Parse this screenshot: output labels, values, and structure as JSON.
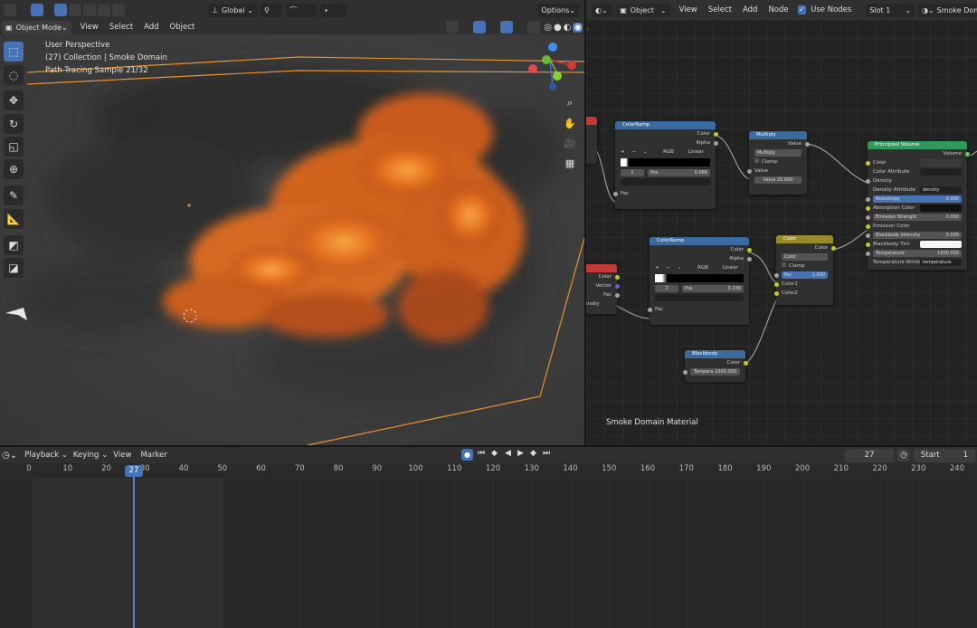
{
  "viewport_header": {
    "mode": "Object Mode",
    "menus": [
      "View",
      "Select",
      "Add",
      "Object"
    ],
    "transform_orientation": "Global",
    "options": "Options"
  },
  "viewport_overlay": {
    "line1": "User Perspective",
    "line2": "(27) Collection | Smoke Domain",
    "line3": "Path Tracing Sample 21/32"
  },
  "node_header": {
    "object": "Object",
    "menus": [
      "View",
      "Select",
      "Add",
      "Node"
    ],
    "use_nodes": "Use Nodes",
    "slot": "Slot 1",
    "material": "Smoke Domain"
  },
  "node_editor": {
    "material_label": "Smoke Domain Material",
    "colorramp1": {
      "title": "ColorRamp",
      "out_color": "Color",
      "out_alpha": "Alpha",
      "mode": "RGB",
      "interp": "Linear",
      "index": "1",
      "pos_label": "Pos",
      "pos": "0.066",
      "in_fac": "Fac"
    },
    "colorramp2": {
      "title": "ColorRamp",
      "out_color": "Color",
      "out_alpha": "Alpha",
      "mode": "RGB",
      "interp": "Linear",
      "index": "2",
      "pos_label": "Pos",
      "pos": "0.239",
      "in_fac": "Fac"
    },
    "multiply": {
      "title": "Multiply",
      "out_value": "Value",
      "op": "Multiply",
      "clamp": "Clamp",
      "in_value": "Value",
      "value_field": "Value 20.000"
    },
    "mix": {
      "title": "Color",
      "out_color": "Color",
      "blend": "Color",
      "clamp": "Clamp",
      "fac": "Fac",
      "fac_val": "1.000",
      "color1": "Color1",
      "color2": "Color2"
    },
    "blackbody": {
      "title": "Blackbody",
      "out_color": "Color",
      "temp": "Tempera 1000.000"
    },
    "attr_node": {
      "color": "Color",
      "vector": "Vector",
      "fac": "Fac",
      "partial": "ensity"
    },
    "principled": {
      "title": "Principled Volume",
      "out": "Volume",
      "rows": [
        "Color",
        "Color Attribute",
        "Density",
        "Density Attribute",
        "Anisotropy",
        "Absorption Color",
        "Emission Strength",
        "Emission Color",
        "Blackbody Intensity",
        "Blackbody Tint",
        "Temperature",
        "Temperature Attribut"
      ],
      "density_attr": "density",
      "anisotropy": "0.000",
      "emission_strength": "0.000",
      "blackbody_intensity": "0.000",
      "temperature": "1000.000",
      "temperature_attr": "temperature"
    }
  },
  "timeline": {
    "menus": [
      "Playback",
      "Keying",
      "View",
      "Marker"
    ],
    "current_frame": "27",
    "start_label": "Start",
    "start_value": "1",
    "ticks": [
      "0",
      "10",
      "20",
      "30",
      "40",
      "50",
      "60",
      "70",
      "80",
      "90",
      "100",
      "110",
      "120",
      "130",
      "140",
      "150",
      "160",
      "170",
      "180",
      "190",
      "200",
      "210",
      "220",
      "230",
      "240"
    ]
  },
  "colors": {
    "accent": "#4772b3",
    "fire": "#e8731f",
    "outline": "#e8922e",
    "playhead": "#5680c2"
  }
}
